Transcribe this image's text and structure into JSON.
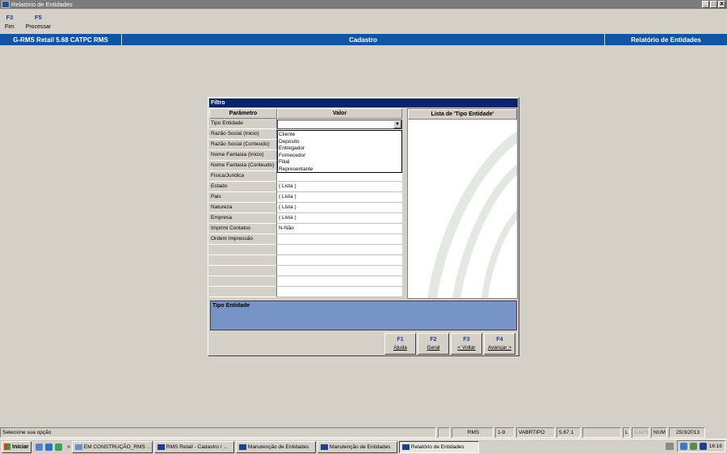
{
  "window": {
    "title": "Relatório de Entidades",
    "controls": [
      "_",
      "□",
      "✕"
    ]
  },
  "function_keys": [
    {
      "key": "F3",
      "label": "Fim"
    },
    {
      "key": "F5",
      "label": "Processar"
    }
  ],
  "header": {
    "system": "G-RMS Retail 5.68 CATPC RMS",
    "section": "Cadastro",
    "page": "Relatório de Entidades"
  },
  "dialog": {
    "title": "Filtro",
    "columns": {
      "param": "Parâmetro",
      "value": "Valor"
    },
    "rows": [
      {
        "param": "Tipo Entidade",
        "value": ""
      },
      {
        "param": "Razão Social (Inicio)",
        "value": ""
      },
      {
        "param": "Razão Social (Conteudo)",
        "value": ""
      },
      {
        "param": "Nome Fantasia (Inicio)",
        "value": ""
      },
      {
        "param": "Nome Fantasia (Conteudo)",
        "value": ""
      },
      {
        "param": "Fisica/Juridica",
        "value": ""
      },
      {
        "param": "Estado",
        "value": "( Lista )"
      },
      {
        "param": "Pais",
        "value": "( Lista )"
      },
      {
        "param": "Natureza",
        "value": "( Lista )"
      },
      {
        "param": "Empresa",
        "value": "( Lista )"
      },
      {
        "param": "Imprimi Contatos",
        "value": "N-Não"
      },
      {
        "param": "Ordem Impressão",
        "value": ""
      },
      {
        "param": "",
        "value": ""
      },
      {
        "param": "",
        "value": ""
      },
      {
        "param": "",
        "value": ""
      },
      {
        "param": "",
        "value": ""
      },
      {
        "param": "",
        "value": ""
      }
    ],
    "dropdown_options": [
      "Cliente",
      "Depósito",
      "Entregador",
      "Fornecedor",
      "Filial",
      "Representante"
    ],
    "list_title": "Lista de 'Tipo Entidade'",
    "description": "Tipo Entidade",
    "buttons": [
      {
        "key": "F1",
        "label": "Ajuda"
      },
      {
        "key": "F2",
        "label": "Geral"
      },
      {
        "key": "F3",
        "label": "< Voltar"
      },
      {
        "key": "F4",
        "label": "Avançar >"
      }
    ]
  },
  "status": {
    "message": "Selecione sua opção",
    "cells": [
      "RMS",
      "1-9",
      "VABRTIPO",
      "5.67.1",
      "L",
      "CAPS",
      "NUM",
      "25/3/2013"
    ]
  },
  "taskbar": {
    "start": "Iniciar",
    "tasks": [
      "EM CONSTRUÇÃO_RMS ...",
      "RMS Retail - Cadastro / ...",
      "Manutenção de Entidades",
      "Manutenção de Entidades",
      "Relatório de Entidades"
    ],
    "clock": "16:16"
  },
  "colors": {
    "header_blue": "#1254a4",
    "dialog_title": "#0a246a",
    "desc_box": "#7695c6"
  }
}
